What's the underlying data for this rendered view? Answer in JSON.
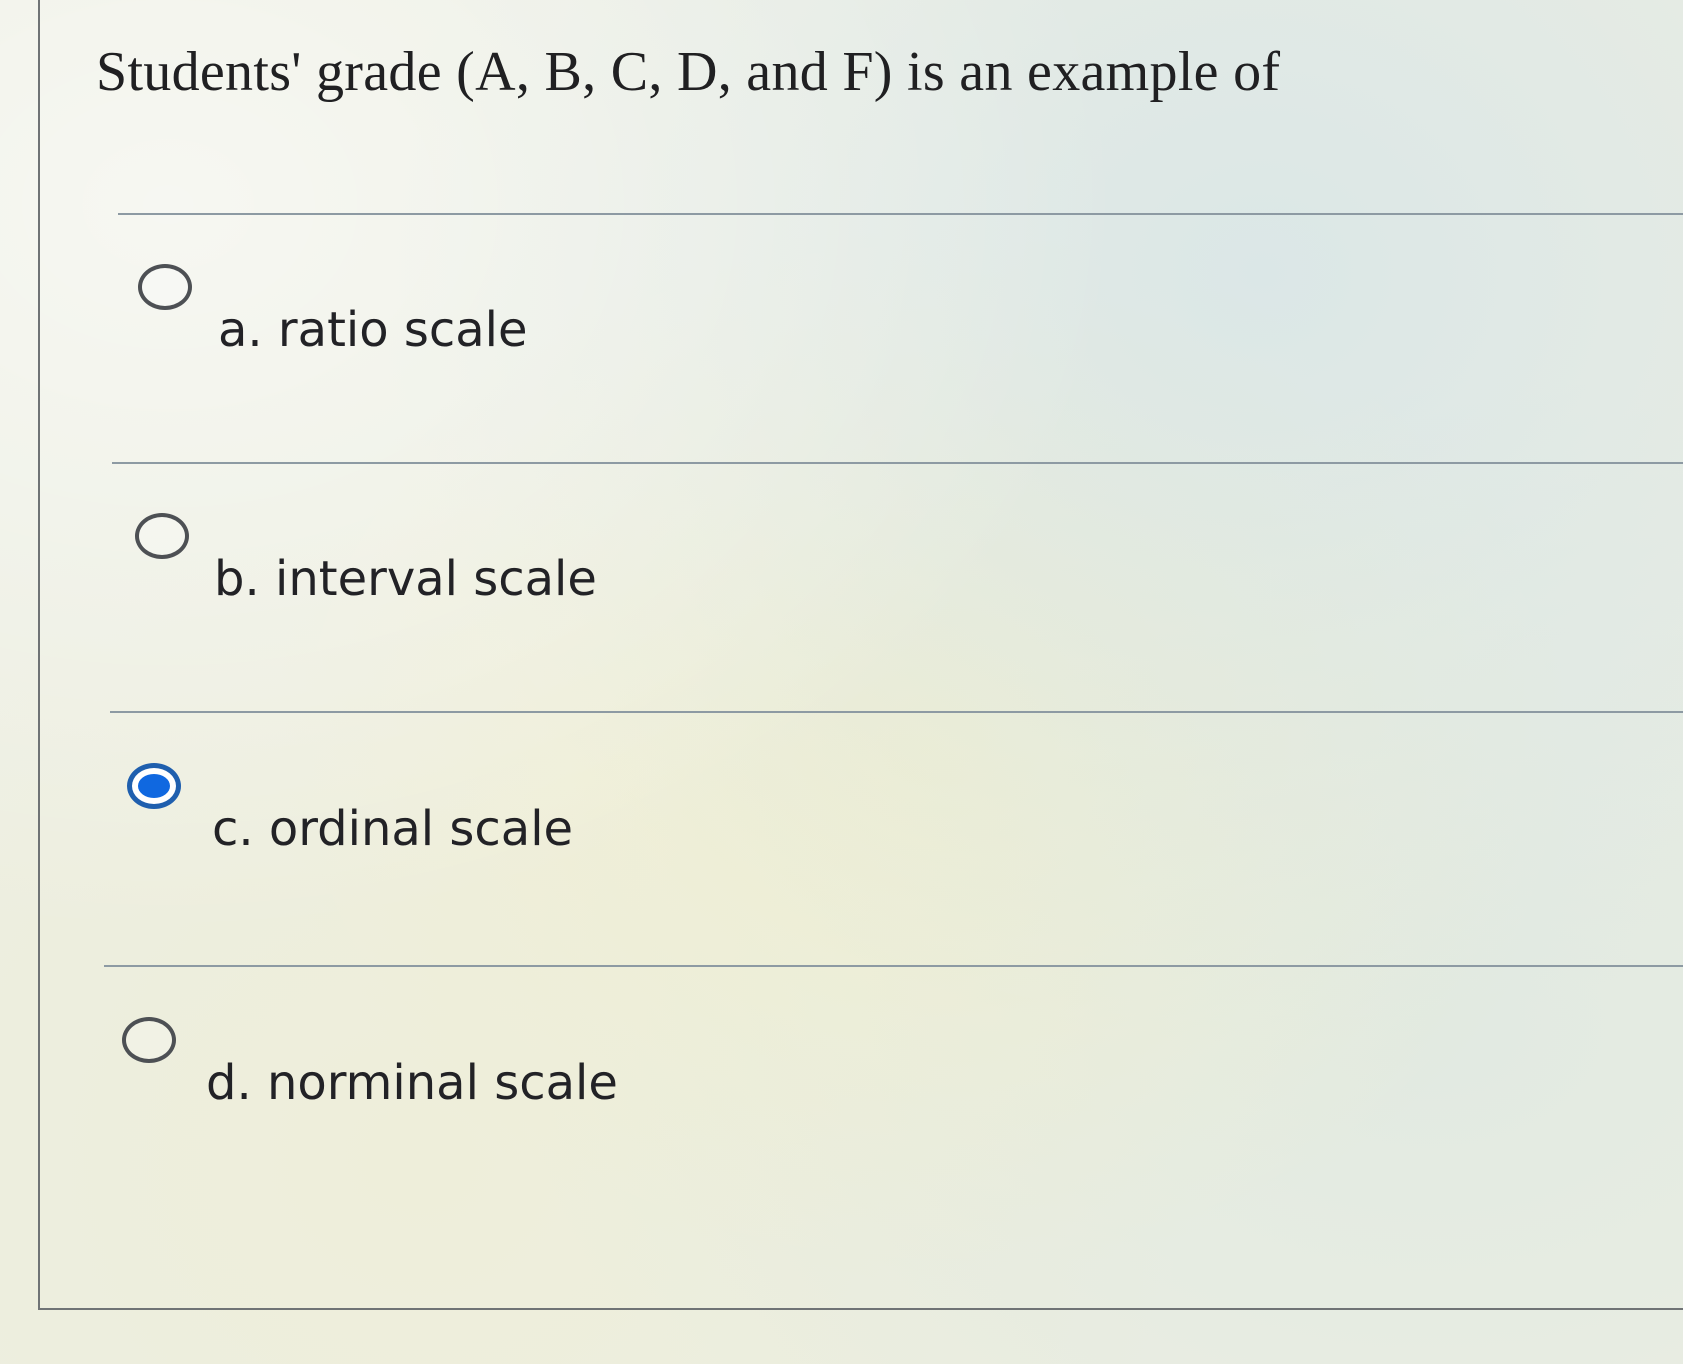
{
  "question": {
    "text": "Students' grade (A, B, C, D, and F) is an example of"
  },
  "options": [
    {
      "label": "a. ratio scale",
      "selected": false
    },
    {
      "label": "b. interval scale",
      "selected": false
    },
    {
      "label": "c. ordinal scale",
      "selected": true
    },
    {
      "label": "d. norminal scale",
      "selected": false
    }
  ],
  "colors": {
    "selected_radio": "#1068e0",
    "divider": "#8d9aa3"
  }
}
